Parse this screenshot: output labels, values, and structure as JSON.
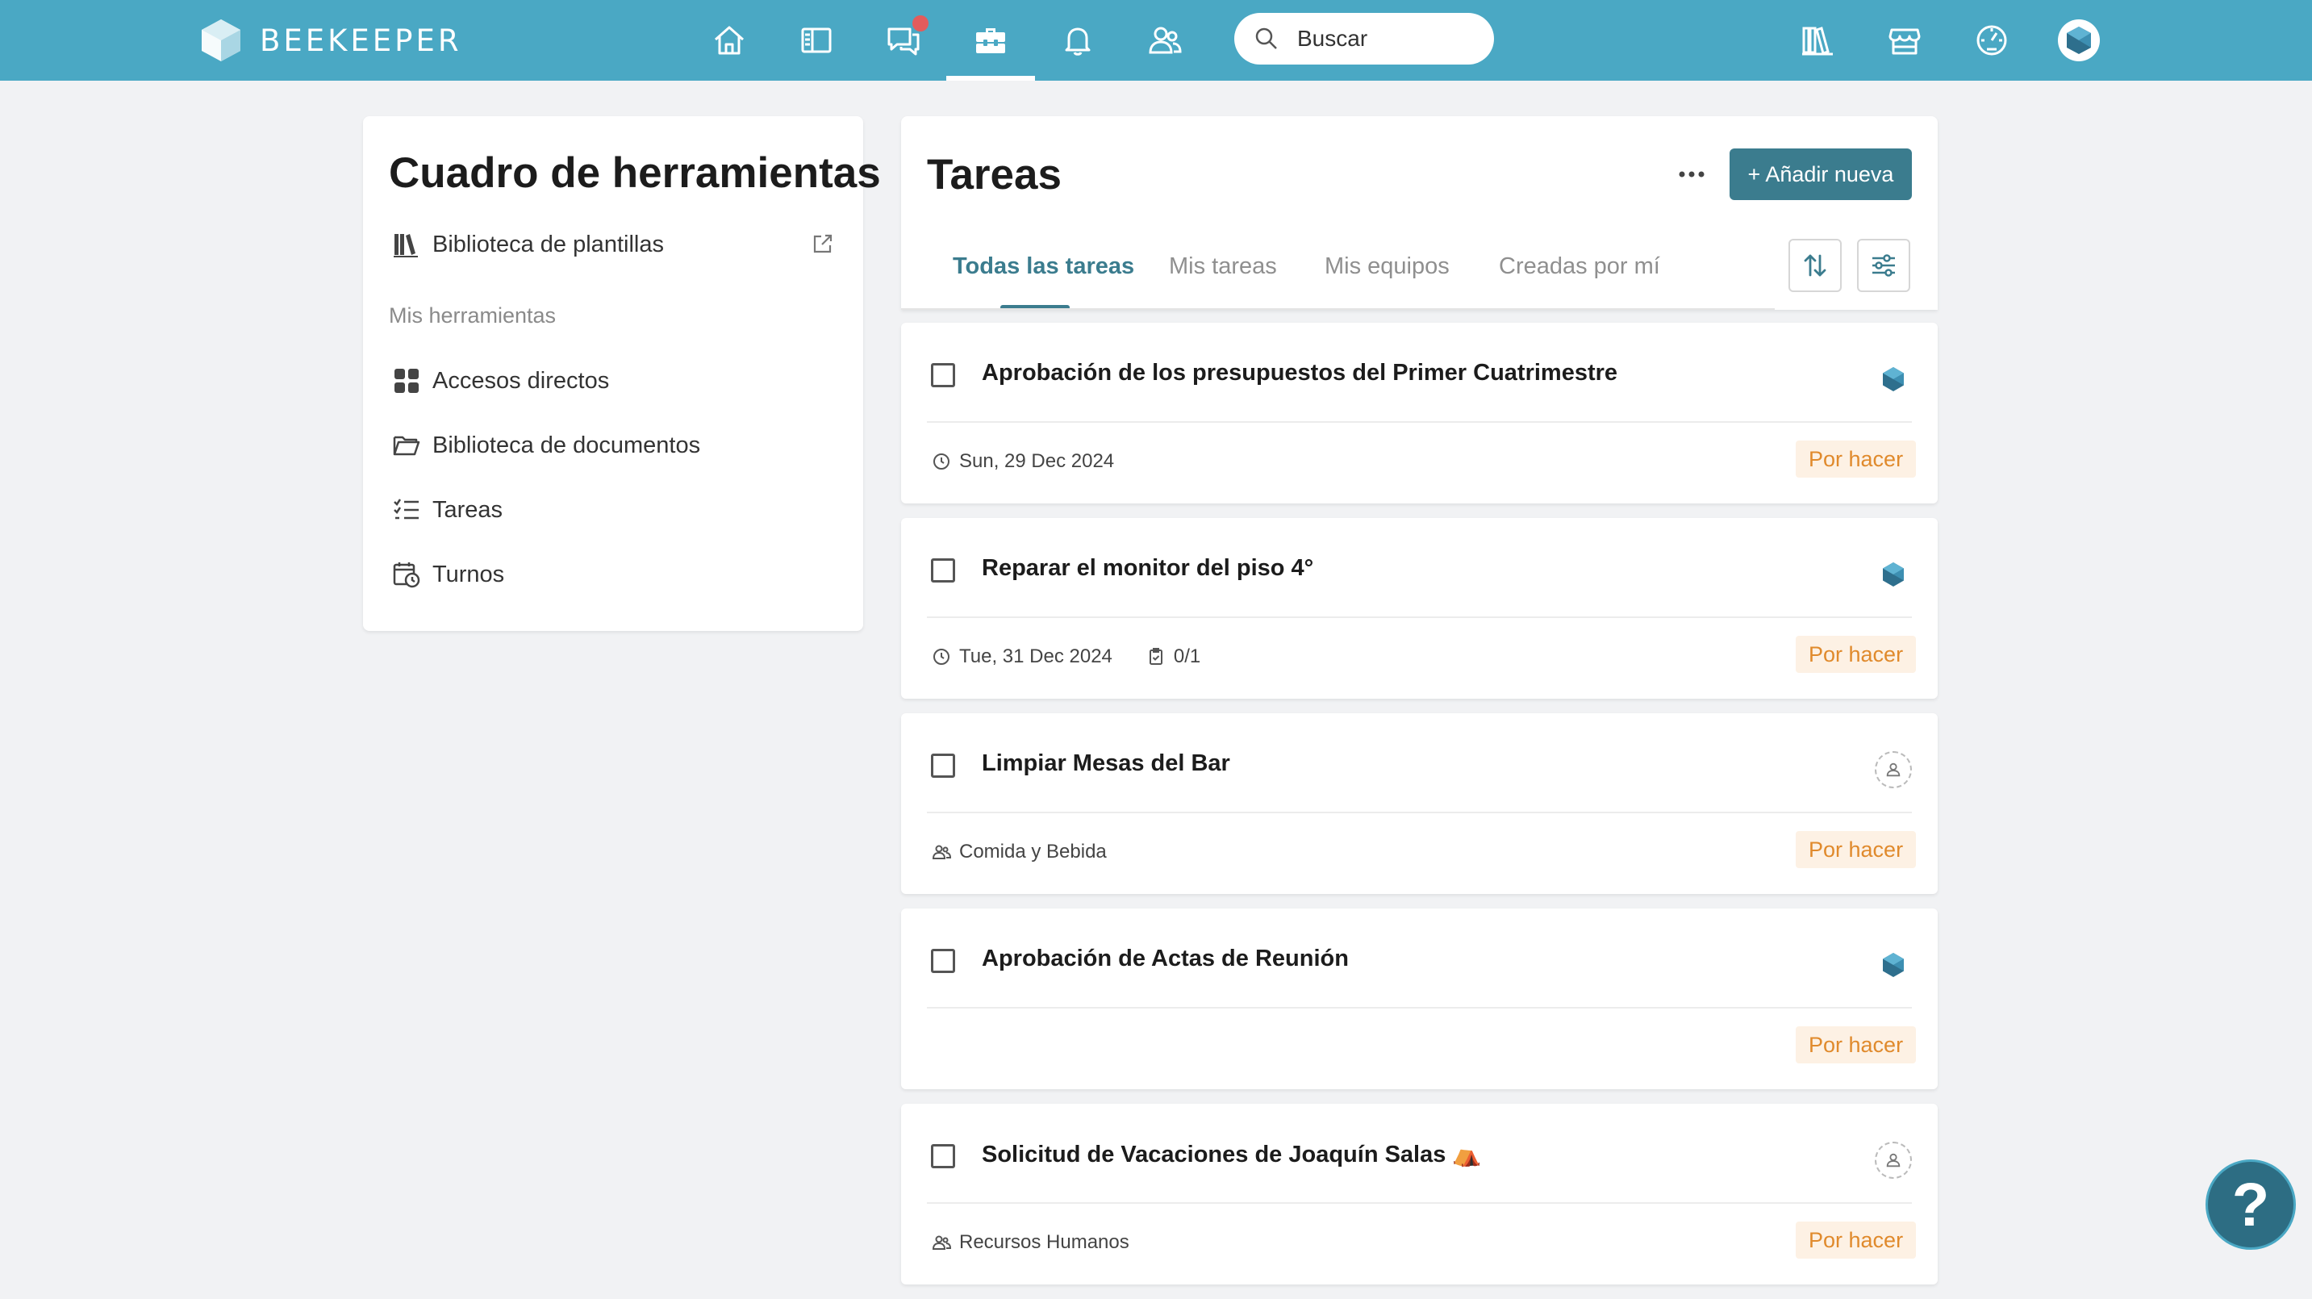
{
  "app": {
    "brand": "BEEKEEPER",
    "brand_color": "#4aa8c4",
    "accent_color": "#3b7c8e"
  },
  "topbar": {
    "nav_icons": [
      "home-icon",
      "streams-icon",
      "chat-icon",
      "toolbox-icon",
      "bell-icon",
      "people-icon"
    ],
    "active_nav": "toolbox-icon",
    "chat_has_unread": true,
    "search_placeholder": "Buscar",
    "right_icons": [
      "library-icon",
      "store-icon",
      "dashboard-icon",
      "profile-avatar"
    ]
  },
  "sidebar": {
    "title": "Cuadro de herramientas",
    "template_library": "Biblioteca de plantillas",
    "section_label": "Mis herramientas",
    "items": [
      {
        "label": "Accesos directos",
        "icon": "grid-icon"
      },
      {
        "label": "Biblioteca de documentos",
        "icon": "folder-icon"
      },
      {
        "label": "Tareas",
        "icon": "checklist-icon"
      },
      {
        "label": "Turnos",
        "icon": "calendar-clock-icon"
      }
    ]
  },
  "tasks": {
    "title": "Tareas",
    "add_button": "+ Añadir nueva",
    "tabs": [
      {
        "label": "Todas las tareas",
        "active": true
      },
      {
        "label": "Mis tareas",
        "active": false
      },
      {
        "label": "Mis equipos",
        "active": false
      },
      {
        "label": "Creadas por mí",
        "active": false
      }
    ],
    "items": [
      {
        "title": "Aprobación de los presupuestos del Primer Cuatrimestre",
        "date": "Sun, 29 Dec 2024",
        "status": "Por hacer",
        "assignee": "avatar"
      },
      {
        "title": "Reparar el monitor del piso 4°",
        "date": "Tue, 31 Dec 2024",
        "subtasks": "0/1",
        "status": "Por hacer",
        "assignee": "avatar"
      },
      {
        "title": "Limpiar Mesas del Bar",
        "team": "Comida y Bebida",
        "status": "Por hacer",
        "assignee": "unassigned"
      },
      {
        "title": "Aprobación de Actas de Reunión",
        "status": "Por hacer",
        "assignee": "avatar"
      },
      {
        "title": "Solicitud de Vacaciones de Joaquín Salas ⛺",
        "team": "Recursos Humanos",
        "status": "Por hacer",
        "assignee": "unassigned"
      }
    ]
  },
  "help": {
    "label": "?"
  }
}
